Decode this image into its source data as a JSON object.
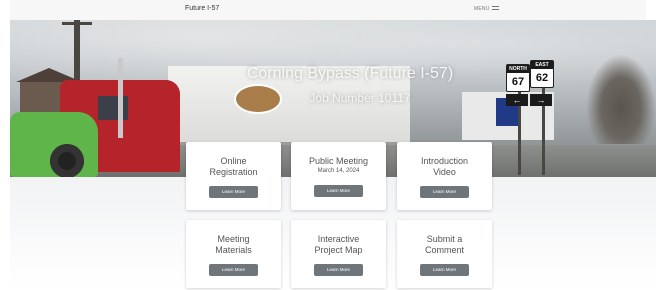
{
  "header": {
    "title": "Future I-57",
    "menu_label": "MENU"
  },
  "hero": {
    "title": "Corning Bypass (Future I-57)",
    "subtitle": "Job Number 10117",
    "signs": [
      {
        "top": "NORTH",
        "number": "67"
      },
      {
        "top": "EAST",
        "number": "62"
      }
    ]
  },
  "cards": [
    {
      "title_line1": "Online",
      "title_line2": "Registration",
      "date": "",
      "button": "Learn More"
    },
    {
      "title_line1": "Public Meeting",
      "title_line2": "",
      "date": "March 14, 2024",
      "button": "Learn More"
    },
    {
      "title_line1": "Introduction",
      "title_line2": "Video",
      "date": "",
      "button": "Learn More"
    },
    {
      "title_line1": "Meeting",
      "title_line2": "Materials",
      "date": "",
      "button": "Learn More"
    },
    {
      "title_line1": "Interactive",
      "title_line2": "Project Map",
      "date": "",
      "button": "Learn More"
    },
    {
      "title_line1": "Submit a",
      "title_line2": "Comment",
      "date": "",
      "button": "Learn More"
    }
  ]
}
